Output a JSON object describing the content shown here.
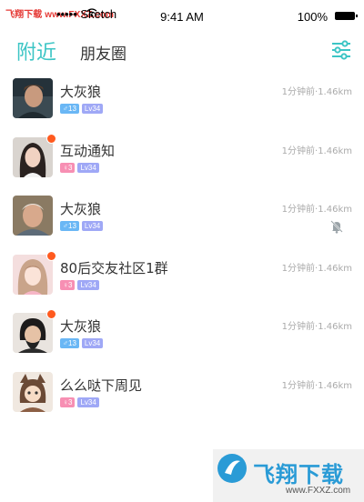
{
  "status_bar": {
    "watermark_top": "飞翔下载 www.FXXZ.com",
    "carrier": "••••• Sketch",
    "time": "9:41 AM",
    "battery": "100%"
  },
  "header": {
    "tabs": [
      {
        "label": "附近",
        "active": true
      },
      {
        "label": "朋友圈",
        "active": false
      }
    ],
    "filter_icon": "sliders-icon",
    "accent_color": "#3cc5c5"
  },
  "list": [
    {
      "name": "大灰狼",
      "unread": false,
      "gender": "male",
      "age": "13",
      "level": "Lv34",
      "meta": "1分钟前·1.46km",
      "muted": false
    },
    {
      "name": "互动通知",
      "unread": true,
      "gender": "female",
      "age": "3",
      "level": "Lv34",
      "meta": "1分钟前·1.46km",
      "muted": false
    },
    {
      "name": "大灰狼",
      "unread": false,
      "gender": "male",
      "age": "13",
      "level": "Lv34",
      "meta": "1分钟前·1.46km",
      "muted": true
    },
    {
      "name": "80后交友社区1群",
      "unread": true,
      "gender": "female",
      "age": "3",
      "level": "Lv34",
      "meta": "1分钟前·1.46km",
      "muted": false
    },
    {
      "name": "大灰狼",
      "unread": true,
      "gender": "male",
      "age": "13",
      "level": "Lv34",
      "meta": "1分钟前·1.46km",
      "muted": false
    },
    {
      "name": "么么哒下周见",
      "unread": false,
      "gender": "female",
      "age": "3",
      "level": "Lv34",
      "meta": "1分钟前·1.46km",
      "muted": false
    }
  ],
  "watermark_bottom": {
    "brand": "飞翔下载",
    "url": "www.FXXZ.com"
  }
}
